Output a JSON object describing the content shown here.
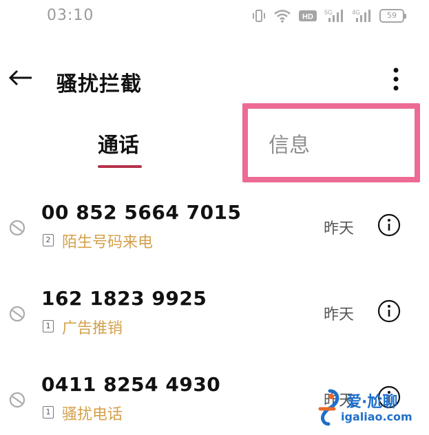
{
  "status_bar": {
    "time": "03:10",
    "battery": "59",
    "icons": [
      "vibrate-icon",
      "wifi-icon",
      "hd-icon",
      "signal-5g-icon",
      "signal-4g-icon",
      "battery-icon"
    ]
  },
  "header": {
    "title": "骚扰拦截",
    "back_icon": "arrow-left-icon",
    "more_icon": "more-vertical-icon"
  },
  "tabs": [
    {
      "label": "通话",
      "active": true
    },
    {
      "label": "信息",
      "active": false
    }
  ],
  "colors": {
    "accent": "#b5314a",
    "highlight": "#ec6a94",
    "tag": "#d4a04a",
    "text_secondary": "#8e8e8e",
    "watermark": "#1f6fc9"
  },
  "calls": [
    {
      "number": "00 852 5664 7015",
      "sim": "2",
      "tag": "陌生号码来电",
      "time": "昨天"
    },
    {
      "number": "162 1823 9925",
      "sim": "1",
      "tag": "广告推销",
      "time": "昨天"
    },
    {
      "number": "0411 8254 4930",
      "sim": "1",
      "tag": "骚扰电话",
      "time": "昨天"
    }
  ],
  "watermark": {
    "text": "爱·尬聊",
    "url": "igaliao.com"
  }
}
